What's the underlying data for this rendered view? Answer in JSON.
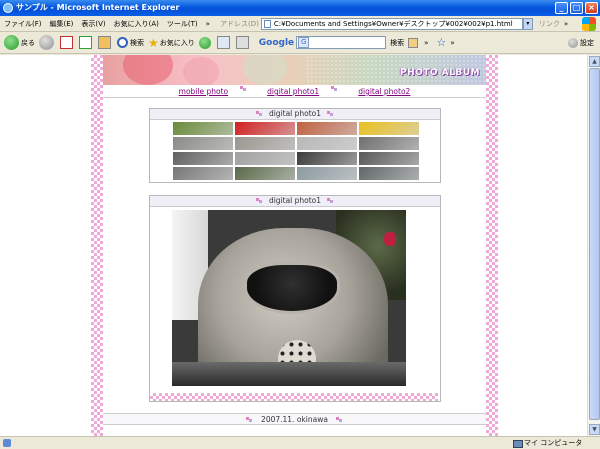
{
  "window": {
    "title": "サンプル - Microsoft Internet Explorer",
    "controls": {
      "minimize": "_",
      "maximize": "□",
      "close": "×"
    }
  },
  "menu": {
    "items": [
      "ファイル(F)",
      "編集(E)",
      "表示(V)",
      "お気に入り(A)",
      "ツール(T)"
    ],
    "chevron": "»",
    "address_label": "アドレス(D)",
    "address_value": "C:¥Documents and Settings¥Owner¥デスクトップ¥002¥002¥p1.html",
    "dropdown": "▾",
    "links_label": "リンク",
    "links_extra": "»"
  },
  "toolbar": {
    "back_label": "戻る",
    "search_label": "検索",
    "favorites_label": "お気に入り",
    "google_label": "Google",
    "google_g": "G",
    "search2_label": "検索",
    "chevron": "»",
    "settings_label": "設定"
  },
  "page": {
    "album_title": "PHOTO ALBUM",
    "nav": [
      "mobile photo",
      "digital photo1",
      "digital photo2"
    ],
    "thumbs_header": "digital photo1",
    "photo_header": "digital photo1",
    "footer": "2007.11. okinawa",
    "thumb_colors": [
      [
        "#6a8a3a",
        "#d02020",
        "#c06040",
        "#e8c020"
      ],
      [
        "#8a8a88",
        "#9a9690",
        "#b8b8b8",
        "#707070"
      ],
      [
        "#606060",
        "#a0a0a0",
        "#3a3a3a",
        "#585858"
      ],
      [
        "#787878",
        "#5a6a4a",
        "#8c9aa0",
        "#606868"
      ]
    ]
  },
  "status": {
    "zone_label": "マイ コンピュータ"
  }
}
